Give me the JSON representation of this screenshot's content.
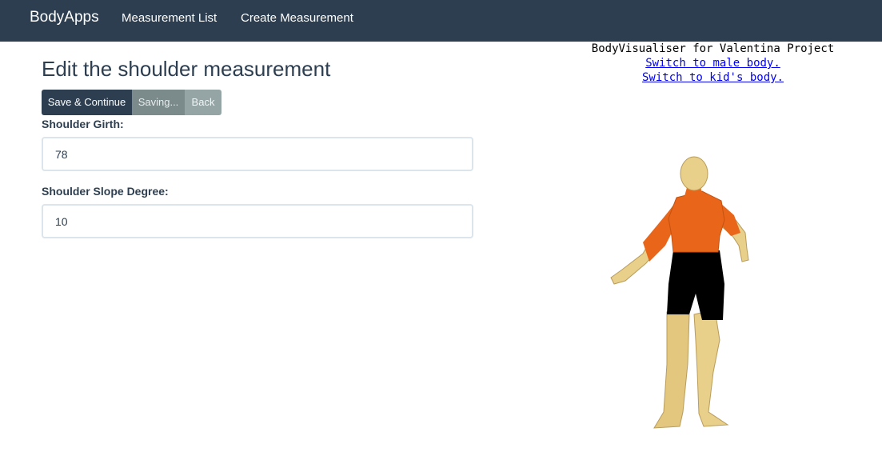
{
  "navbar": {
    "brand": "BodyApps",
    "links": [
      "Measurement List",
      "Create Measurement"
    ]
  },
  "page": {
    "title": "Edit the shoulder measurement"
  },
  "buttons": {
    "save": "Save & Continue",
    "saving": "Saving...",
    "back": "Back"
  },
  "fields": [
    {
      "label": "Shoulder Girth:",
      "value": "78"
    },
    {
      "label": "Shoulder Slope Degree:",
      "value": "10"
    }
  ],
  "visualiser": {
    "title": "BodyVisualiser for Valentina Project",
    "link_male": "Switch to male body.",
    "link_kid": "Switch to kid's body."
  },
  "colors": {
    "navbar": "#2c3e50",
    "skin": "#e8cf8a",
    "shirt": "#e8651a",
    "shorts": "#000000",
    "link": "#0000ee"
  }
}
